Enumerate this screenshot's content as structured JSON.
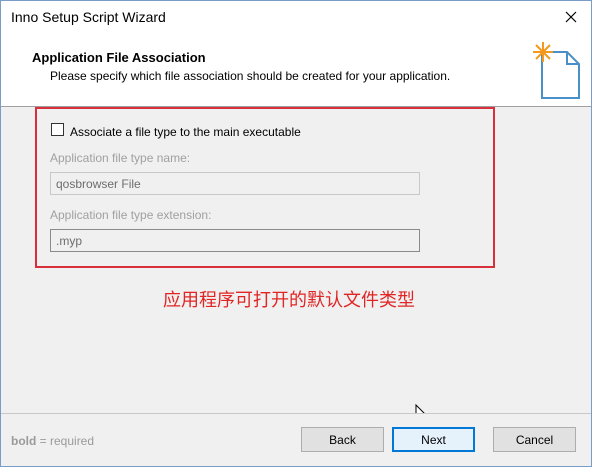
{
  "window": {
    "title": "Inno Setup Script Wizard"
  },
  "header": {
    "title": "Application File Association",
    "subtitle": "Please specify which file association should be created for your application."
  },
  "form": {
    "associate_checkbox": {
      "label": "Associate a file type to the main executable",
      "checked": false
    },
    "file_type_name": {
      "label": "Application file type name:",
      "value": "qosbrowser File"
    },
    "file_type_extension": {
      "label": "Application file type extension:",
      "value": ".myp"
    }
  },
  "annotation": {
    "text": "应用程序可打开的默认文件类型",
    "color": "#e12525"
  },
  "footer": {
    "note_bold": "bold",
    "note_rest": " = required",
    "back_label": "Back",
    "next_label": "Next",
    "cancel_label": "Cancel"
  },
  "colors": {
    "accent": "#0078d7",
    "highlight_box": "#d8303a"
  }
}
